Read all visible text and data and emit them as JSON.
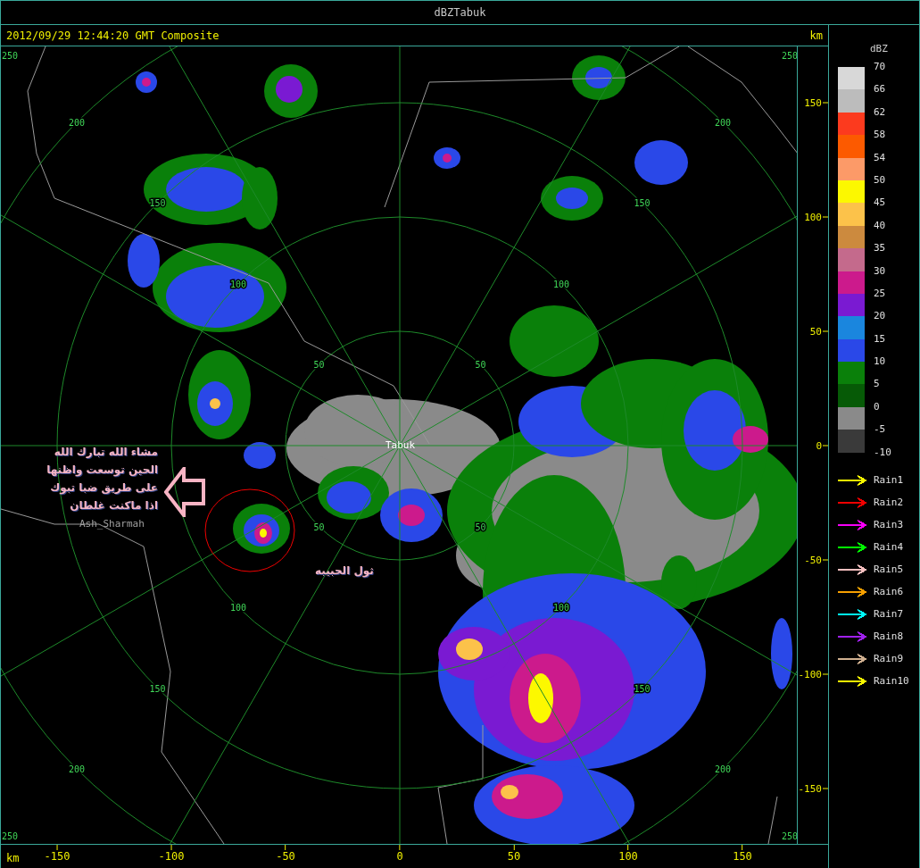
{
  "window": {
    "title": "dBZTabuk"
  },
  "header": {
    "timestamp": "2012/09/29 12:44:20 GMT Composite",
    "unit": "km"
  },
  "map": {
    "range_rings": [
      {
        "labels": [
          "50",
          "50",
          "50",
          "50"
        ]
      },
      {
        "labels": [
          "100",
          "100",
          "100",
          "100"
        ]
      },
      {
        "labels": [
          "150",
          "150",
          "150",
          "150"
        ]
      },
      {
        "labels": [
          "200",
          "200",
          "200",
          "200"
        ]
      },
      {
        "labels": [
          "250",
          "250",
          "250",
          "250"
        ]
      }
    ],
    "places": [
      {
        "name": "Tabuk",
        "kind": "station"
      },
      {
        "name": "Ash_Sharmah",
        "kind": "town"
      }
    ],
    "annotations": {
      "note": "مشاء الله تبارك الله الحين توسعت واظنها على طريق ضبا تبوك اذا ماكنت غلطان",
      "cell_label": "ثول الحبيبه"
    }
  },
  "y_axis": {
    "ticks": [
      "150",
      "100",
      "50",
      "0",
      "-50",
      "-100",
      "-150"
    ]
  },
  "x_axis": {
    "unit": "km",
    "ticks": [
      "-150",
      "-100",
      "-50",
      "0",
      "50",
      "100",
      "150"
    ]
  },
  "legend": {
    "title": "dBZ",
    "scale": [
      {
        "label": "70",
        "color": "#d8d8d8"
      },
      {
        "label": "66",
        "color": "#bcbcbc"
      },
      {
        "label": "62",
        "color": "#fc3a1e"
      },
      {
        "label": "58",
        "color": "#fc5a00"
      },
      {
        "label": "54",
        "color": "#fc9a68"
      },
      {
        "label": "50",
        "color": "#fcf800"
      },
      {
        "label": "45",
        "color": "#fcc24a"
      },
      {
        "label": "40",
        "color": "#cc8a3e"
      },
      {
        "label": "35",
        "color": "#c46a8c"
      },
      {
        "label": "30",
        "color": "#cc1a8c"
      },
      {
        "label": "25",
        "color": "#7a1ad2"
      },
      {
        "label": "20",
        "color": "#1a86de"
      },
      {
        "label": "15",
        "color": "#2a48e8"
      },
      {
        "label": "10",
        "color": "#0a800a"
      },
      {
        "label": "5",
        "color": "#065a06"
      },
      {
        "label": "0",
        "color": "#8a8a8a"
      },
      {
        "label": "-5",
        "color": "#3a3a3a"
      }
    ],
    "scale_end": "-10",
    "tracks": [
      {
        "label": "Rain1",
        "color": "#f8f800"
      },
      {
        "label": "Rain2",
        "color": "#f00000"
      },
      {
        "label": "Rain3",
        "color": "#f800f8"
      },
      {
        "label": "Rain4",
        "color": "#00f800"
      },
      {
        "label": "Rain5",
        "color": "#f8c0c0"
      },
      {
        "label": "Rain6",
        "color": "#f8a000"
      },
      {
        "label": "Rain7",
        "color": "#00f8f8"
      },
      {
        "label": "Rain8",
        "color": "#a020f0"
      },
      {
        "label": "Rain9",
        "color": "#d0b090"
      },
      {
        "label": "Rain10",
        "color": "#f8f800"
      }
    ]
  }
}
